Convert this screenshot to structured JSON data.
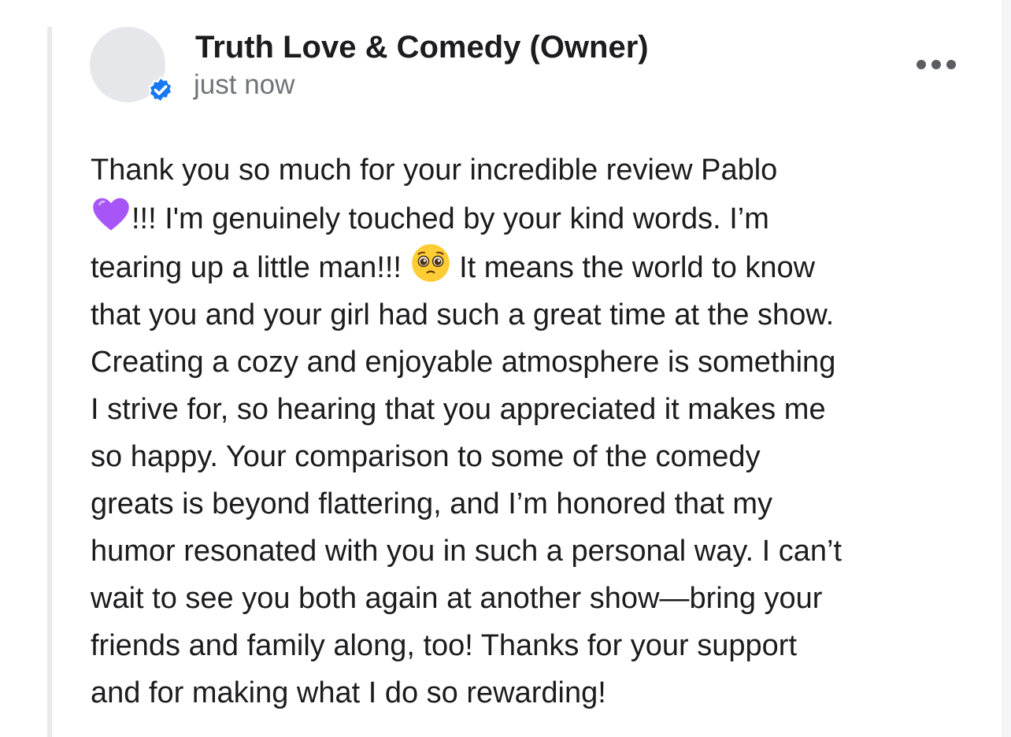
{
  "post": {
    "author": "Truth Love & Comedy (Owner)",
    "timestamp": "just now",
    "verified_icon": "verified-badge-icon",
    "more_icon": "more-horizontal-icon",
    "body_lines": [
      [
        "Thank you so much for your incredible review Pablo"
      ],
      [
        "",
        "!!! I'm genuinely touched by your kind words. I’m"
      ],
      [
        "tearing up a little man!!! ",
        " It means the world to know"
      ],
      [
        "that you and your girl had such a great time at the show."
      ],
      [
        "Creating a cozy and enjoyable atmosphere is something"
      ],
      [
        "I strive for, so hearing that you appreciated it makes me"
      ],
      [
        "so happy. Your comparison to some of the comedy"
      ],
      [
        "greats is beyond flattering, and I’m honored that my"
      ],
      [
        "humor resonated with you in such a personal way. I can’t"
      ],
      [
        "wait to see you both again at another show—bring your"
      ],
      [
        "friends and family along, too! Thanks for your support"
      ],
      [
        "and for making what I do so rewarding!"
      ]
    ],
    "emojis": {
      "heart": "purple-heart-emoji",
      "pleading": "pleading-face-emoji"
    }
  },
  "colors": {
    "verified_blue": "#1877f2",
    "heart_purple": "#a855f7",
    "emoji_yellow": "#ffcc33"
  }
}
